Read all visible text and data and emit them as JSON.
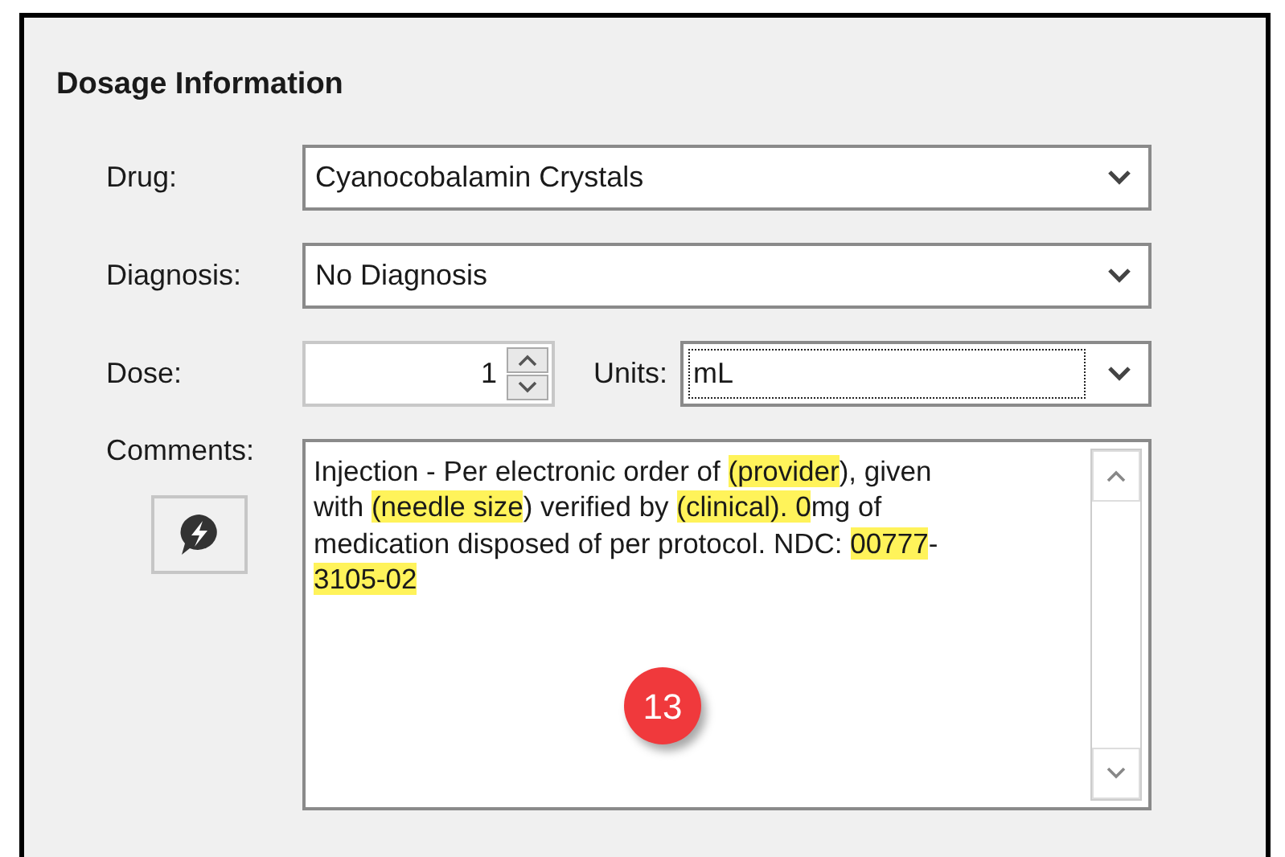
{
  "section": {
    "title": "Dosage Information"
  },
  "drug": {
    "label": "Drug:",
    "value": "Cyanocobalamin Crystals"
  },
  "diagnosis": {
    "label": "Diagnosis:",
    "value": "No Diagnosis"
  },
  "dose": {
    "label": "Dose:",
    "value": "1"
  },
  "units": {
    "label": "Units:",
    "value": "mL",
    "focused": true
  },
  "comments": {
    "label": "Comments:",
    "lines": [
      [
        {
          "text": "Injection - Per electronic order of ",
          "highlight": false
        },
        {
          "text": "(provider",
          "highlight": true
        },
        {
          "text": "), given",
          "highlight": false
        }
      ],
      [
        {
          "text": "with ",
          "highlight": false
        },
        {
          "text": "(needle size",
          "highlight": true
        },
        {
          "text": ") verified by ",
          "highlight": false
        },
        {
          "text": "(clinical). 0",
          "highlight": true
        },
        {
          "text": "mg of",
          "highlight": false
        }
      ],
      [
        {
          "text": "medication disposed of per protocol. NDC: ",
          "highlight": false
        },
        {
          "text": "00777",
          "highlight": true
        },
        {
          "text": "-",
          "highlight": false
        }
      ],
      [
        {
          "text": "3105-02 ",
          "highlight": true
        }
      ]
    ]
  },
  "callout": "13"
}
